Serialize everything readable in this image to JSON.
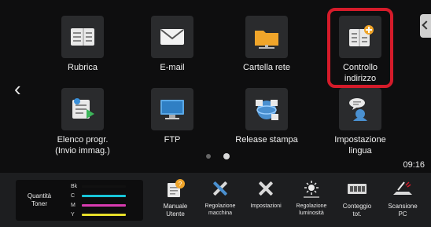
{
  "tiles": [
    {
      "label": "Rubrica",
      "icon": "address-book-icon"
    },
    {
      "label": "E-mail",
      "icon": "email-icon"
    },
    {
      "label": "Cartella rete",
      "icon": "folder-icon"
    },
    {
      "label": "Controllo indirizzo",
      "line1": "Controllo",
      "line2": "indirizzo",
      "icon": "address-check-icon"
    },
    {
      "label": "Elenco progr. (Invio immag.)",
      "line1": "Elenco progr.",
      "line2": "(Invio immag.)",
      "icon": "program-list-icon"
    },
    {
      "label": "FTP",
      "icon": "ftp-icon"
    },
    {
      "label": "Release stampa",
      "icon": "print-release-icon"
    },
    {
      "label": "Impostazione lingua",
      "line1": "Impostazione",
      "line2": "lingua",
      "icon": "language-icon"
    }
  ],
  "clock": "09:16",
  "toner": {
    "title_line1": "Quantità",
    "title_line2": "Toner",
    "rows": [
      {
        "label": "Bk",
        "color": "#111111"
      },
      {
        "label": "C",
        "color": "#17c5d8"
      },
      {
        "label": "M",
        "color": "#d83bb0"
      },
      {
        "label": "Y",
        "color": "#e6de2a"
      }
    ]
  },
  "bottom": [
    {
      "line1": "Manuale",
      "line2": "Utente",
      "icon": "manual-icon"
    },
    {
      "line1": "Regolazione",
      "line2": "macchina",
      "icon": "tools-icon"
    },
    {
      "line1": "Impostazioni",
      "line2": "",
      "icon": "settings-icon"
    },
    {
      "line1": "Regolazione",
      "line2": "luminosità",
      "icon": "brightness-icon"
    },
    {
      "line1": "Conteggio",
      "line2": "tot.",
      "icon": "counter-icon"
    },
    {
      "line1": "Scansione",
      "line2": "PC",
      "icon": "scan-pc-icon"
    }
  ],
  "colors": {
    "highlight": "#d51b2a",
    "background": "#0e0e0f"
  }
}
